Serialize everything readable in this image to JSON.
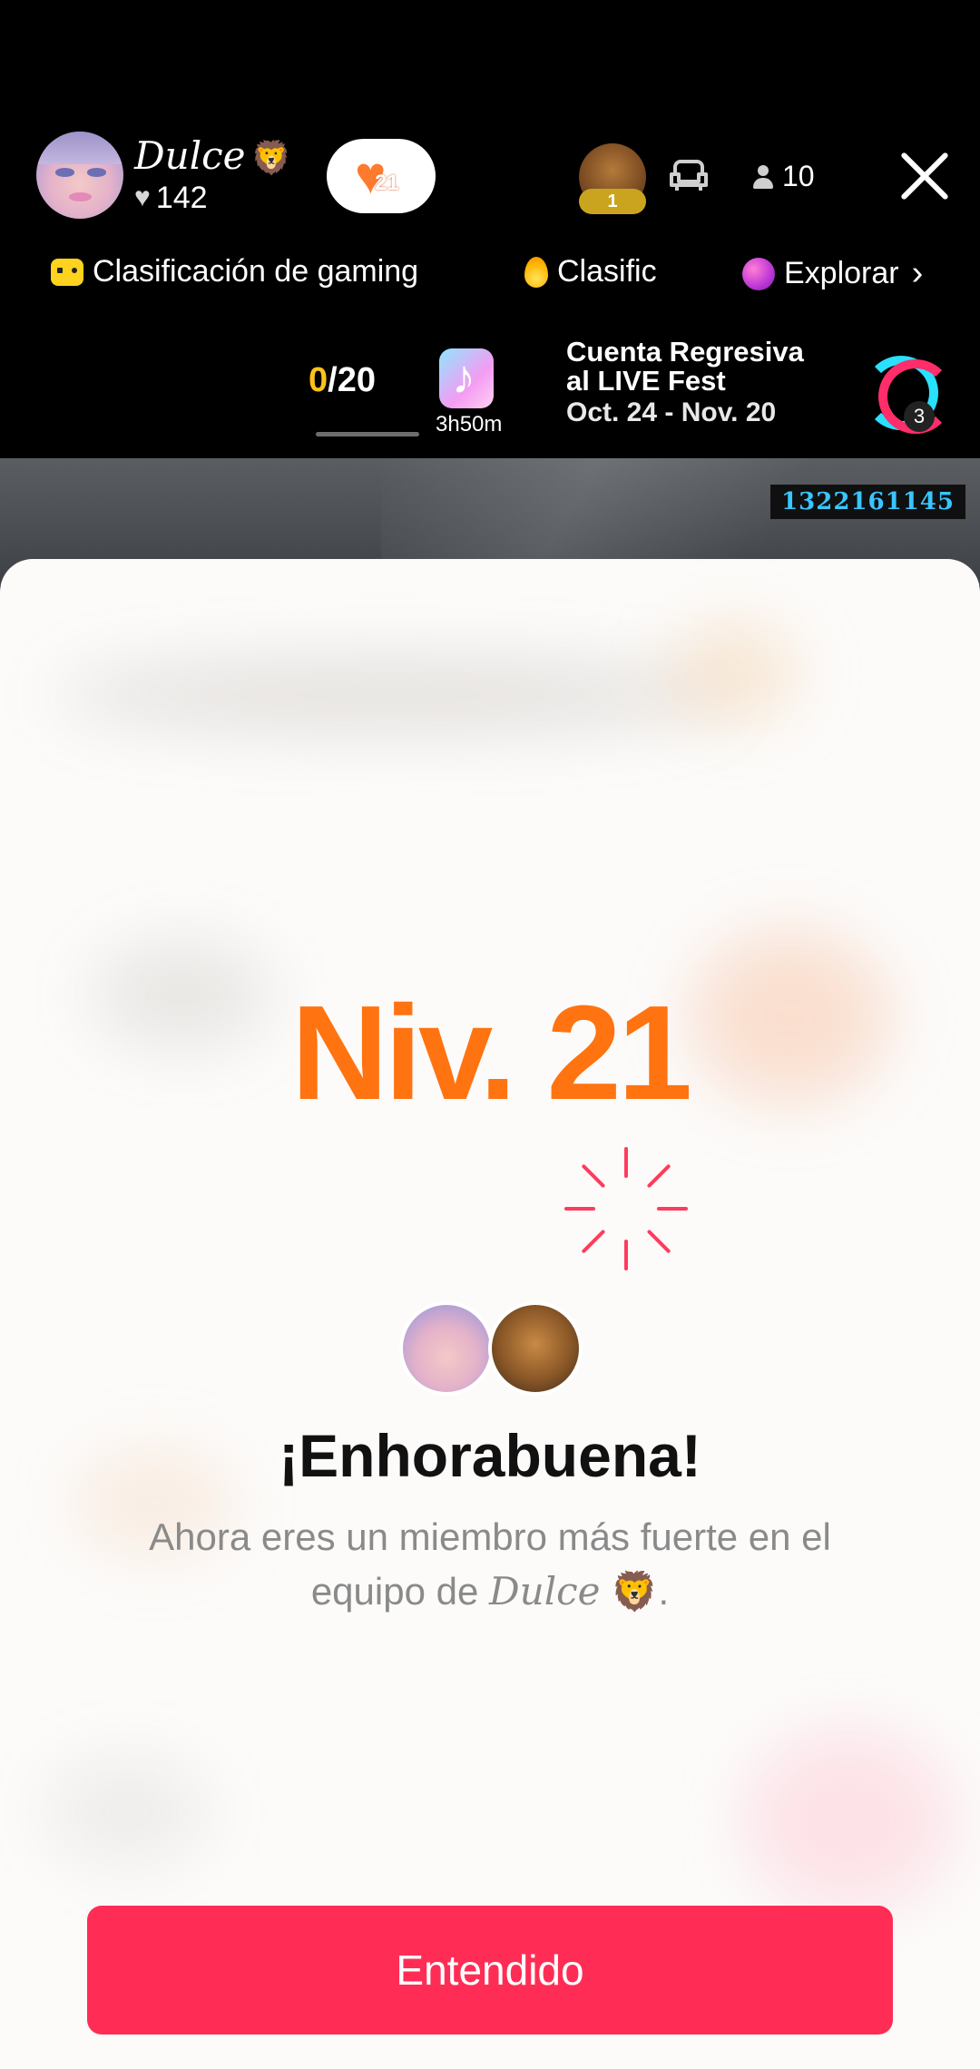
{
  "host": {
    "name": "Dulce",
    "name_emoji": "🦁",
    "likes": "142"
  },
  "fan_badge": {
    "level": "21",
    "icon": "heart-icon"
  },
  "top_viewer": {
    "rank": "1"
  },
  "viewer_count": "10",
  "rankings": {
    "gaming": "Clasificación de gaming",
    "clasific": "Clasific",
    "explore": "Explorar"
  },
  "goal": {
    "current": "0",
    "total": "/20",
    "progress": 0
  },
  "timer": "3h50m",
  "event": {
    "title_line1": "Cuenta Regresiva",
    "title_line2": "al LIVE Fest",
    "dates": "Oct. 24 - Nov. 20",
    "logo_badge": "3"
  },
  "stream_id": "1322161145",
  "levelup": {
    "level_text": "Niv. 21",
    "title": "¡Enhorabuena!",
    "desc_line1": "Ahora eres un miembro más fuerte en el",
    "desc_pre": "equipo de ",
    "desc_name": "Dulce",
    "desc_emoji": "🦁",
    "desc_post": ".",
    "button": "Entendido"
  },
  "colors": {
    "accent_orange": "#ff7310",
    "button_red": "#ff2d55",
    "goal_yellow": "#ffc21a"
  }
}
